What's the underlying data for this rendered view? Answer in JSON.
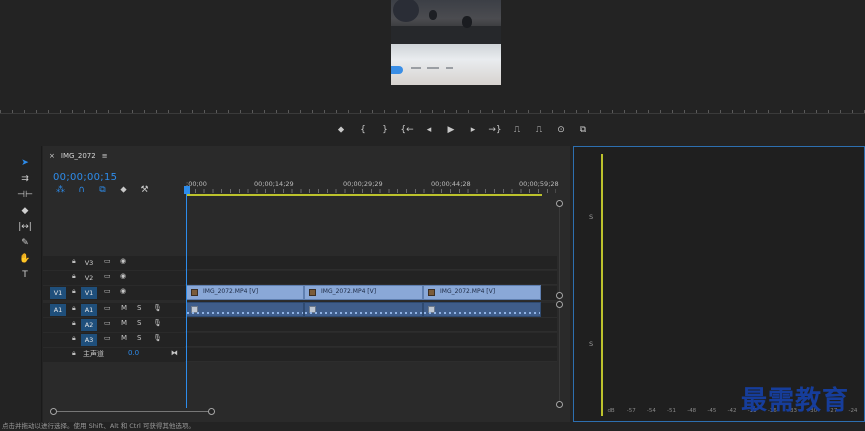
{
  "transport": {
    "items": [
      "marker-icon",
      "mark-in-icon",
      "mark-out-icon",
      "go-to-in-icon",
      "step-back-icon",
      "play-icon",
      "step-forward-icon",
      "go-to-out-icon",
      "lift-icon",
      "extract-icon",
      "export-frame-icon",
      "compare-icon"
    ],
    "glyphs": [
      "⬥",
      "{",
      "}",
      "{←",
      "◂",
      "▶",
      "▸",
      "→}",
      "⎍",
      "⎍",
      "⊙",
      "⧉"
    ]
  },
  "tools": {
    "items": [
      "selection-tool-icon",
      "track-select-tool-icon",
      "ripple-edit-tool-icon",
      "razor-tool-icon",
      "slip-tool-icon",
      "pen-tool-icon",
      "hand-tool-icon",
      "type-tool-icon"
    ],
    "glyphs": [
      "➤",
      "⇉",
      "⊣⊢",
      "◆",
      "|↔|",
      "✎",
      "✋",
      "T"
    ]
  },
  "timeline": {
    "close_glyph": "×",
    "sequence_name": "IMG_2072",
    "menu_glyph": "≡",
    "timecode": "00;00;00;15",
    "ruler_labels": [
      ";00;00",
      "00;00;14;29",
      "00;00;29;29",
      "00;00;44;28",
      "00;00;59;28"
    ],
    "tracks": [
      {
        "name": "V3",
        "source": ""
      },
      {
        "name": "V2",
        "source": ""
      },
      {
        "name": "V1",
        "source": "V1"
      },
      {
        "name": "A1",
        "source": "A1"
      },
      {
        "name": "A2",
        "source": ""
      },
      {
        "name": "A3",
        "source": ""
      }
    ],
    "audio_controls": {
      "mute": "M",
      "solo": "S"
    },
    "master_label": "主声道",
    "master_value": "0.0",
    "clips": [
      "IMG_2072.MP4 [V]",
      "IMG_2072.MP4 [V]",
      "IMG_2072.MP4 [V]"
    ]
  },
  "audio_meter": {
    "side_labels": [
      "S",
      "S"
    ],
    "scale": [
      "dB",
      "-57",
      "-54",
      "-51",
      "-48",
      "-45",
      "-42",
      "-39",
      "-36",
      "-33",
      "-30",
      "-27",
      "-24"
    ]
  },
  "status_bar": {
    "text": "点击并拖动以进行选择。使用 Shift、Alt 和 Ctrl 可获得其他选项。"
  },
  "watermark": {
    "text": "最需教育"
  },
  "colors": {
    "accent": "#2d8ceb",
    "video_clip": "#8aa8d7",
    "audio_clip": "#3f5d8a",
    "work_area": "#bcc22c",
    "watermark": "#163d9b"
  }
}
